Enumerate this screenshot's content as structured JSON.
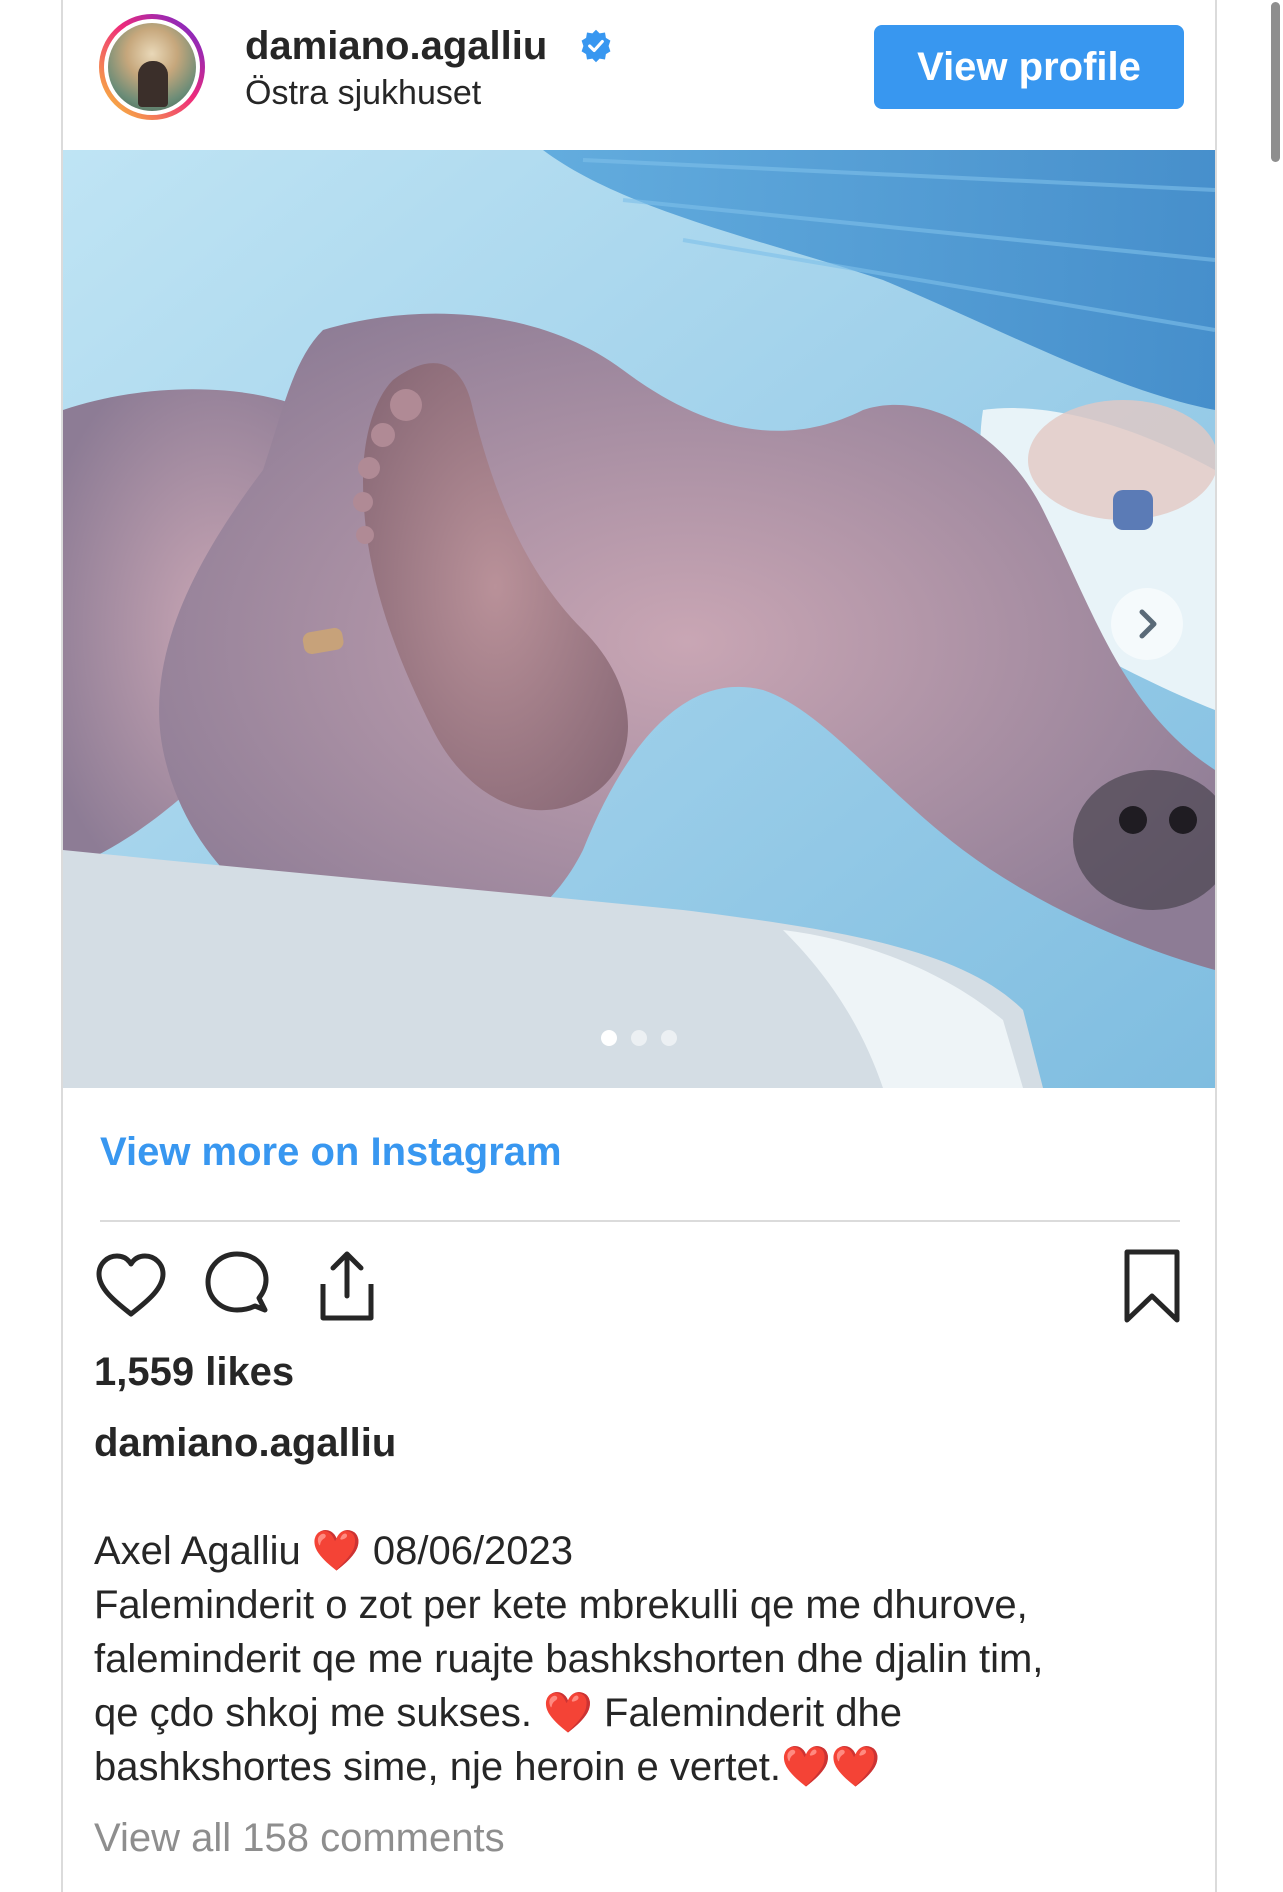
{
  "post": {
    "username": "damiano.agalliu",
    "location": "Östra sjukhuset",
    "view_profile_label": "View profile",
    "view_more_label": "View more on Instagram",
    "likes_text": "1,559 likes",
    "caption_username": "damiano.agalliu",
    "caption_lines": {
      "line1_text": "Axel Agalliu ",
      "line1_heart": "❤️",
      "line1_date": " 08/06/2023",
      "line2": "Faleminderit o zot per kete mbrekulli qe me dhurove,",
      "line3": "faleminderit qe me ruajte bashkshorten dhe djalin tim,",
      "line4_text": "qe çdo shkoj me sukses. ",
      "line4_heart": "❤️",
      "line4_text2": " Faleminderit dhe",
      "line5_text": "bashkshortes sime, nje heroin e vertet.",
      "line5_hearts": "❤️❤️"
    },
    "view_comments_label": "View all 158 comments",
    "carousel": {
      "slide_count": 3,
      "active_index": 0
    }
  },
  "icons": {
    "verified": "verified-badge-icon",
    "next": "chevron-right-icon",
    "like": "heart-outline-icon",
    "comment": "comment-bubble-icon",
    "share": "share-upload-icon",
    "save": "bookmark-icon"
  },
  "colors": {
    "accent": "#3897f0",
    "text": "#262626",
    "muted": "#8e8e8e",
    "divider": "#dbdbdb",
    "heart": "#e0242f"
  }
}
